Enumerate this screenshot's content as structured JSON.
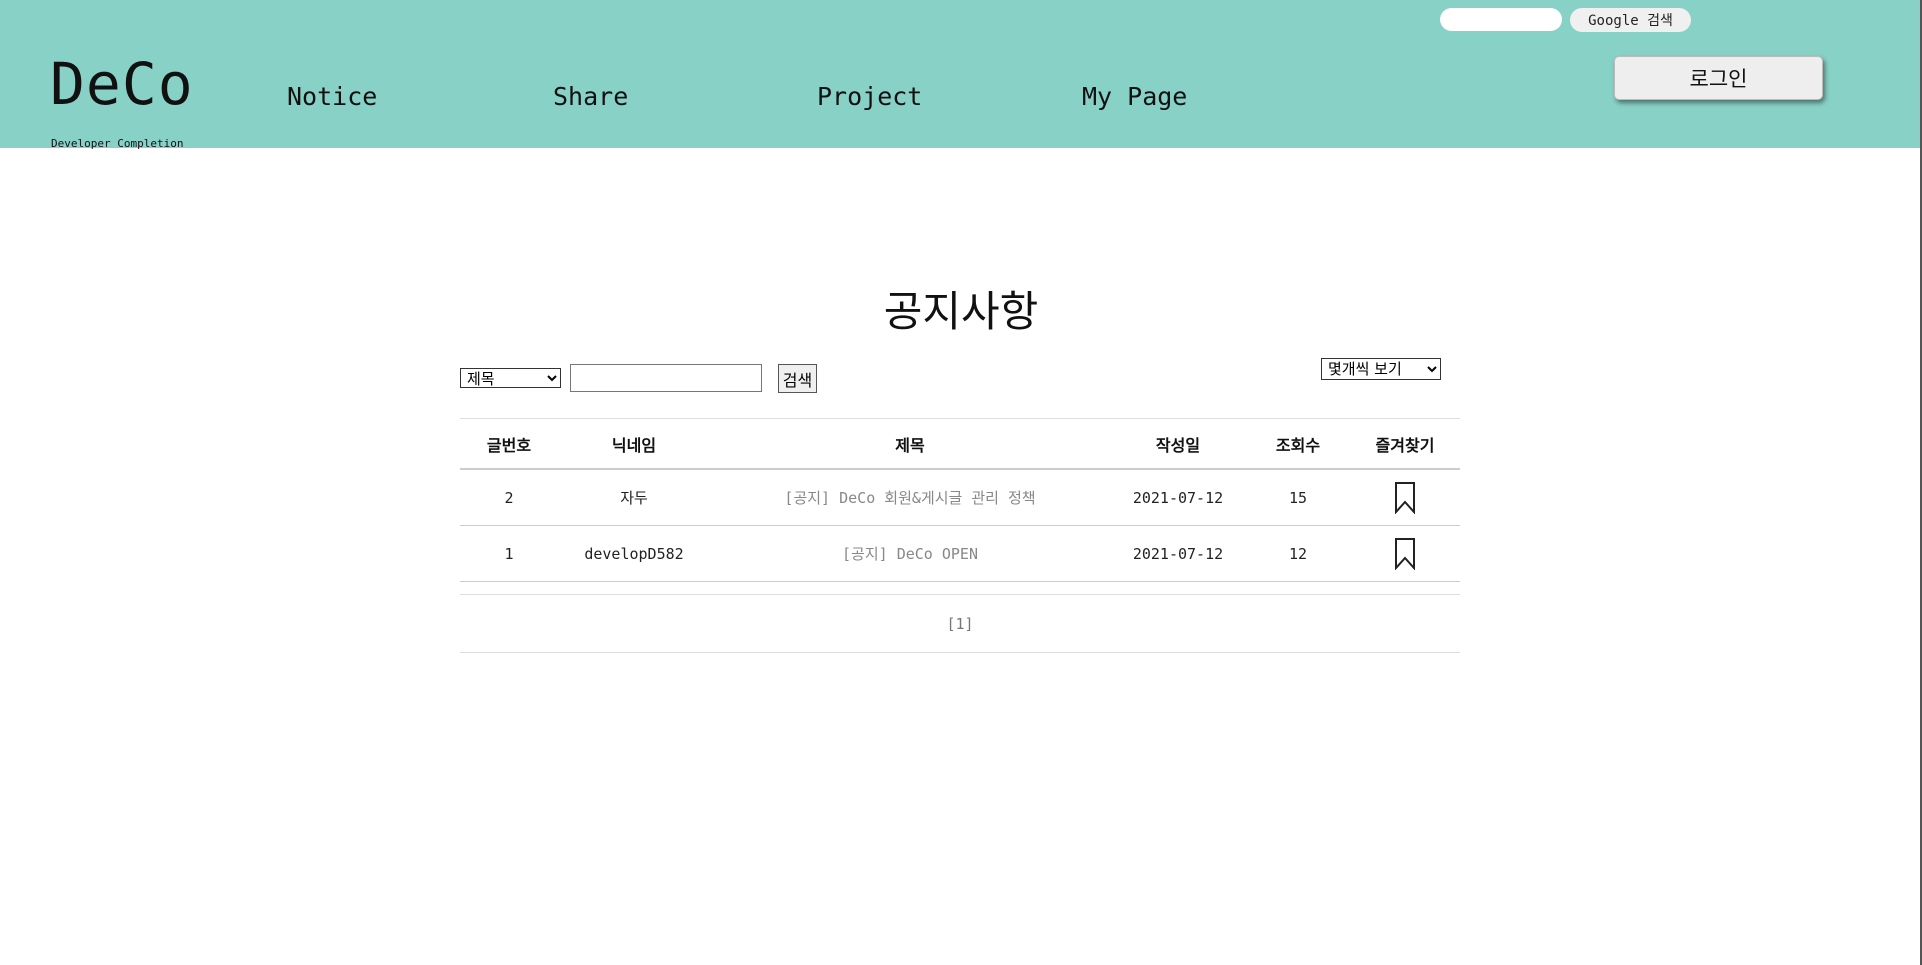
{
  "header": {
    "logo": "DeCo",
    "logo_subtitle": "Developer Completion",
    "nav": [
      "Notice",
      "Share",
      "Project",
      "My Page"
    ],
    "google_search": {
      "input_value": "",
      "button_label": "Google 검색"
    },
    "login_label": "로그인",
    "colors": {
      "header_bg": "#88d1c6"
    }
  },
  "main": {
    "title": "공지사항",
    "search": {
      "field_options": [
        "제목"
      ],
      "field_selected": "제목",
      "query": "",
      "button_label": "검색"
    },
    "page_size_label": "몇개씩 보기",
    "table": {
      "columns": [
        "글번호",
        "닉네임",
        "제목",
        "작성일",
        "조회수",
        "즐겨찾기"
      ],
      "rows": [
        {
          "no": "2",
          "nickname": "자두",
          "title": "[공지] DeCo 회원&게시글 관리 정책",
          "date": "2021-07-12",
          "views": "15",
          "bookmark_icon": "bookmark-outline-icon"
        },
        {
          "no": "1",
          "nickname": "developD582",
          "title": "[공지] DeCo OPEN",
          "date": "2021-07-12",
          "views": "12",
          "bookmark_icon": "bookmark-outline-icon"
        }
      ]
    },
    "pagination": "[1]"
  }
}
